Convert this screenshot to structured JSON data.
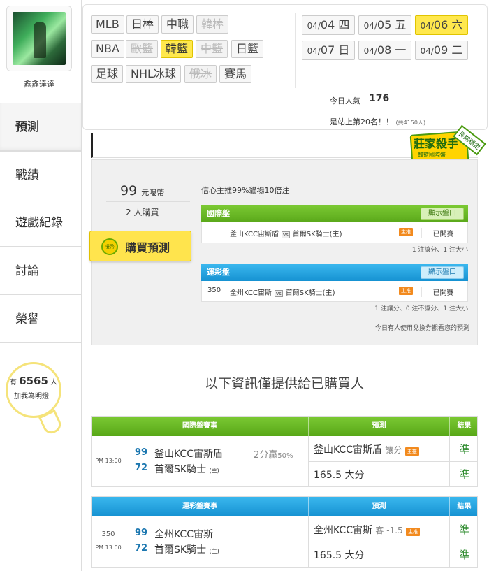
{
  "user": {
    "name": "鑫鑫達達"
  },
  "nav": [
    {
      "label": "預測",
      "active": true
    },
    {
      "label": "戰績",
      "active": false
    },
    {
      "label": "遊戲紀錄",
      "active": false
    },
    {
      "label": "討論",
      "active": false
    },
    {
      "label": "榮譽",
      "active": false
    }
  ],
  "lamp": {
    "prefix": "有",
    "count": "6565",
    "suffix": "人",
    "caption": "加我為明燈"
  },
  "leagues": {
    "row1": [
      "MLB",
      "日棒",
      "中職",
      "韓棒"
    ],
    "row2": [
      "NBA",
      "歐籃",
      "韓籃",
      "中籃",
      "日籃"
    ],
    "row3": [
      "足球",
      "NHL冰球",
      "俄冰",
      "賽馬"
    ]
  },
  "dates": {
    "d1": {
      "md": "04/",
      "day": "04",
      "wd": "四"
    },
    "d2": {
      "md": "04/",
      "day": "05",
      "wd": "五"
    },
    "d3": {
      "md": "04/",
      "day": "06",
      "wd": "六"
    },
    "d4": {
      "md": "04/",
      "day": "07",
      "wd": "日"
    },
    "d5": {
      "md": "04/",
      "day": "08",
      "wd": "一"
    },
    "d6": {
      "md": "04/",
      "day": "09",
      "wd": "二"
    }
  },
  "stats": {
    "pop_label": "今日人氣",
    "pop_value": "176",
    "rank_text": "是站上第20名！！",
    "rank_total": "(共4150人)"
  },
  "badge": {
    "title": "莊家殺手",
    "sub": "韓籃國際盤",
    "side": "長期穩定"
  },
  "prediction": {
    "price": "99",
    "price_unit": "元嘍幣",
    "buyers": "2",
    "buyers_unit": "人購買",
    "buy_label": "購買預測",
    "buy_icon": "嘍幣",
    "confidence": "信心主推99%貓場10倍注"
  },
  "intl_market": {
    "title": "國際盤",
    "show_label": "顯示盤口",
    "num": "",
    "home": "釜山KCC宙斯盾",
    "vs": "vs",
    "away": "首爾SK騎士(主)",
    "host": "主推",
    "status": "已開賽",
    "foot": "1 注讓分、1 注大小"
  },
  "lottery_market": {
    "title": "運彩盤",
    "show_label": "顯示盤口",
    "num": "350",
    "home": "全州KCC宙斯",
    "vs": "vs",
    "away": "首爾SK騎士(主)",
    "host": "主推",
    "status": "已開賽",
    "foot": "1 注讓分、0 注不讓分、1 注大小"
  },
  "exchange_note": "今日有人使用兌換券觀看您的預測",
  "info_title": "以下資訊僅提供給已購買人",
  "table1": {
    "h_match": "國際盤賽事",
    "h_pred": "預測",
    "h_res": "結果",
    "time": "PM 13:00",
    "num": "",
    "s1": "99",
    "s2": "72",
    "team1": "釜山KCC宙斯盾",
    "team2": "首爾SK騎士",
    "host_mark": "(主)",
    "note": "2分贏",
    "note_pct": "50%",
    "pred1": "釜山KCC宙斯盾",
    "pred1_sub": "讓分",
    "pred_tag": "主推",
    "pred2": "165.5 大分",
    "res1": "準",
    "res2": "準"
  },
  "table2": {
    "h_match": "運彩盤賽事",
    "h_pred": "預測",
    "h_res": "結果",
    "time": "PM 13:00",
    "num": "350",
    "s1": "99",
    "s2": "72",
    "team1": "全州KCC宙斯",
    "team2": "首爾SK騎士",
    "host_mark": "(主)",
    "pred1": "全州KCC宙斯",
    "pred1_sub": "客 -1.5",
    "pred_tag": "主推",
    "pred2": "165.5 大分",
    "res1": "準",
    "res2": "準"
  }
}
